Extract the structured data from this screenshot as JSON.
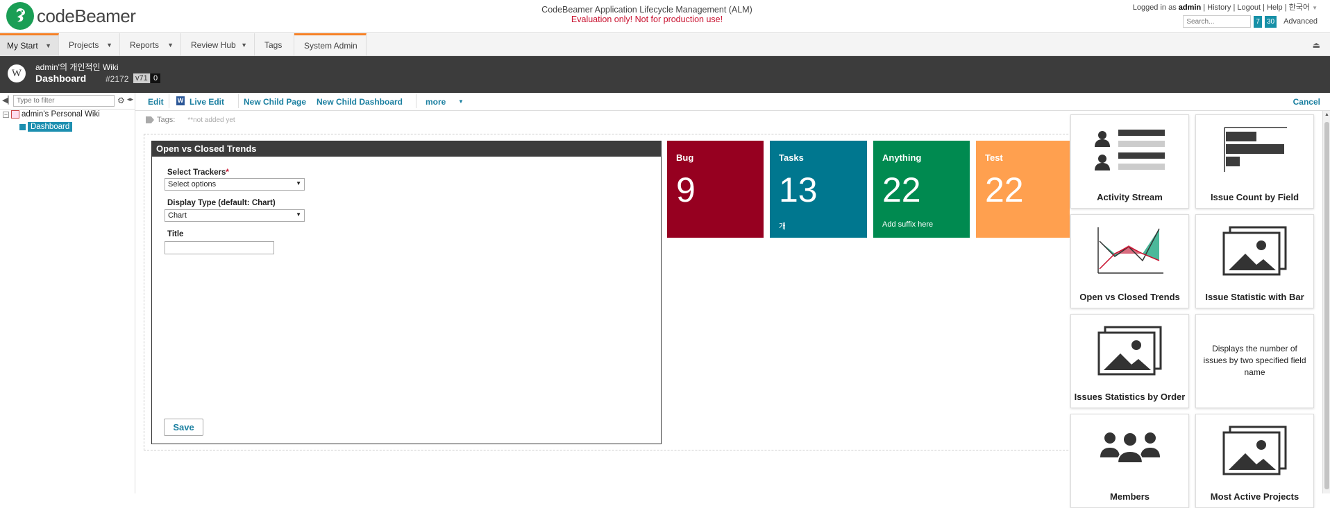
{
  "header": {
    "logo_text": "codeBeamer",
    "app_title": "CodeBeamer Application Lifecycle Management (ALM)",
    "eval_notice": "Evaluation only! Not for production use!",
    "user": {
      "logged_in_prefix": "Logged in as",
      "username": "admin",
      "links": [
        "History",
        "Logout",
        "Help",
        "한국어"
      ]
    },
    "search_placeholder": "Search...",
    "badge_a": "7",
    "badge_b": "30",
    "advanced_label": "Advanced"
  },
  "menu": [
    {
      "label": "My Start",
      "active": true
    },
    {
      "label": "Projects"
    },
    {
      "label": "Reports"
    },
    {
      "label": "Review Hub"
    },
    {
      "label": "Tags"
    },
    {
      "label": "System Admin"
    }
  ],
  "page": {
    "wiki_name": "admin'의 개인적인 Wiki",
    "title": "Dashboard",
    "id": "#2172",
    "version": "v71",
    "count": "0",
    "wiki_icon": "W"
  },
  "toolbar": {
    "edit": "Edit",
    "live_edit": "Live Edit",
    "new_child_page": "New Child Page",
    "new_child_dashboard": "New Child Dashboard",
    "more": "more",
    "cancel": "Cancel"
  },
  "tree": {
    "filter_placeholder": "Type to filter",
    "root": "admin's Personal Wiki",
    "child": "Dashboard"
  },
  "tags": {
    "label": "Tags:",
    "value": "**not added yet"
  },
  "widget": {
    "title": "Open vs Closed Trends",
    "trackers_label": "Select Trackers",
    "trackers_required": "*",
    "trackers_value": "Select options",
    "display_label": "Display Type (default: Chart)",
    "display_value": "Chart",
    "title_label": "Title",
    "title_value": "",
    "save": "Save"
  },
  "tiles": [
    {
      "title": "Bug",
      "value": "9",
      "suffix": "",
      "color": "#960020"
    },
    {
      "title": "Tasks",
      "value": "13",
      "suffix": "개",
      "color": "#00778f"
    },
    {
      "title": "Anything",
      "value": "22",
      "suffix": "Add suffix here",
      "color": "#008a50"
    },
    {
      "title": "Test",
      "value": "22",
      "suffix": "",
      "color": "#ffa04f"
    }
  ],
  "widget_library": [
    {
      "label": "Activity Stream",
      "icon": "activity-stream-icon"
    },
    {
      "label": "Issue Count by Field",
      "icon": "bar-chart-icon"
    },
    {
      "label": "Open vs Closed Trends",
      "icon": "trend-chart-icon"
    },
    {
      "label": "Issue Statistic with Bar",
      "icon": "image-placeholder-icon"
    },
    {
      "label": "Issues Statistics by Order",
      "icon": "image-placeholder-icon"
    },
    {
      "label": "",
      "description": "Displays the number of issues by two specified field name"
    },
    {
      "label": "Members",
      "icon": "members-icon"
    },
    {
      "label": "Most Active Projects",
      "icon": "image-placeholder-icon"
    }
  ]
}
